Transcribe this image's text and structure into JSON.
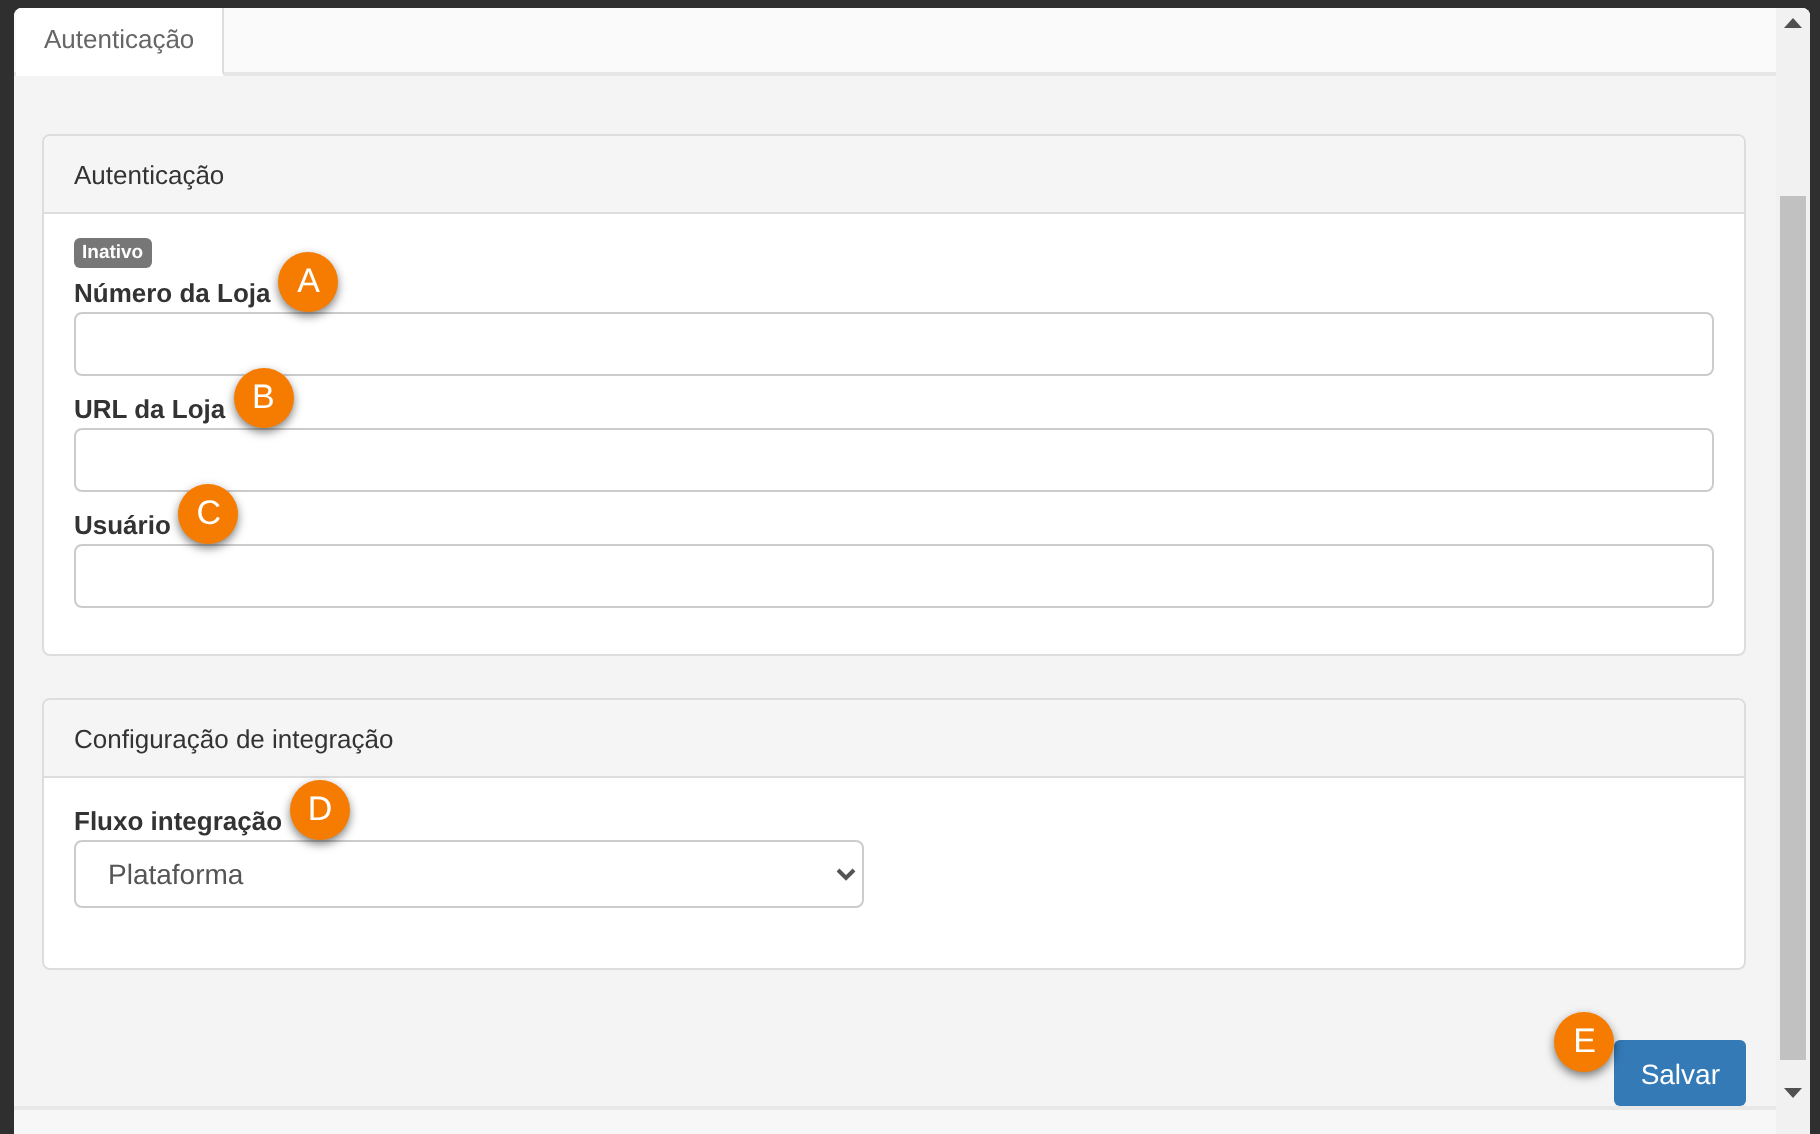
{
  "tabs": [
    {
      "label": "Autenticação",
      "selected": true
    }
  ],
  "panels": [
    {
      "title": "Autenticação",
      "status_badge": "Inativo",
      "fields": [
        {
          "kind": "text",
          "label": "Número da Loja",
          "marker": "A"
        },
        {
          "kind": "text",
          "label": "URL da Loja",
          "marker": "B"
        },
        {
          "kind": "text",
          "label": "Usuário",
          "marker": "C"
        }
      ]
    },
    {
      "title": "Configuração de integração",
      "fields": [
        {
          "kind": "select",
          "label": "Fluxo integração",
          "marker": "D",
          "value": "Plataforma"
        }
      ]
    }
  ],
  "save_button": {
    "label": "Salvar",
    "marker": "E"
  }
}
